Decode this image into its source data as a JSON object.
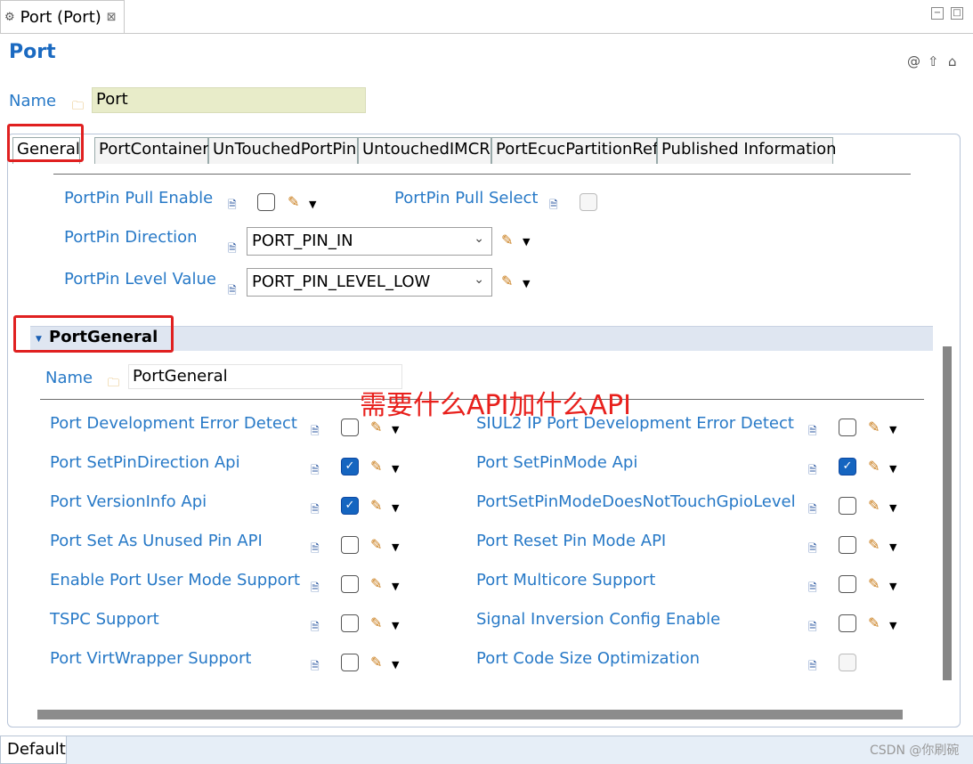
{
  "editor_tab": {
    "title": "Port (Port)",
    "close": "⊠"
  },
  "window_buttons": {
    "minimize": "−",
    "maximize": "□"
  },
  "form": {
    "title": "Port",
    "icons": [
      "@",
      "⇧",
      "⌂"
    ]
  },
  "name_row": {
    "label": "Name",
    "value": "Port"
  },
  "tabs": [
    "General",
    "PortContainer",
    "UnTouchedPortPin",
    "UntouchedIMCR",
    "PortEcucPartitionRef",
    "Published Information"
  ],
  "pin_fields": {
    "pull_enable_label": "PortPin Pull Enable",
    "pull_select_label": "PortPin Pull Select",
    "direction_label": "PortPin Direction",
    "direction_value": "PORT_PIN_IN",
    "level_label": "PortPin Level Value",
    "level_value": "PORT_PIN_LEVEL_LOW"
  },
  "section": {
    "title": "PortGeneral",
    "name_label": "Name",
    "name_value": "PortGeneral"
  },
  "annotation": "需要什么API加什么API",
  "left_rows": [
    {
      "label": "Port Development Error Detect",
      "checked": false
    },
    {
      "label": "Port SetPinDirection Api",
      "checked": true
    },
    {
      "label": "Port VersionInfo Api",
      "checked": true
    },
    {
      "label": "Port Set As Unused Pin API",
      "checked": false
    },
    {
      "label": "Enable Port User Mode Support",
      "checked": false
    },
    {
      "label": "TSPC Support",
      "checked": false
    },
    {
      "label": "Port VirtWrapper Support",
      "checked": false
    }
  ],
  "right_rows": [
    {
      "label": "SIUL2 IP Port Development Error Detect",
      "checked": false
    },
    {
      "label": "Port SetPinMode Api",
      "checked": true
    },
    {
      "label": "PortSetPinModeDoesNotTouchGpioLevel",
      "checked": false
    },
    {
      "label": "Port Reset Pin Mode API",
      "checked": false
    },
    {
      "label": "Port Multicore Support",
      "checked": false
    },
    {
      "label": "Signal Inversion Config Enable",
      "checked": false
    },
    {
      "label": "Port Code Size Optimization",
      "checked": false
    }
  ],
  "bottom": {
    "default_tab": "Default",
    "watermark": "CSDN @你刷碗"
  },
  "colors": {
    "label": "#2779c7",
    "annotation": "#e8201c",
    "highlight": "#e02020",
    "checked": "#1565c0"
  }
}
